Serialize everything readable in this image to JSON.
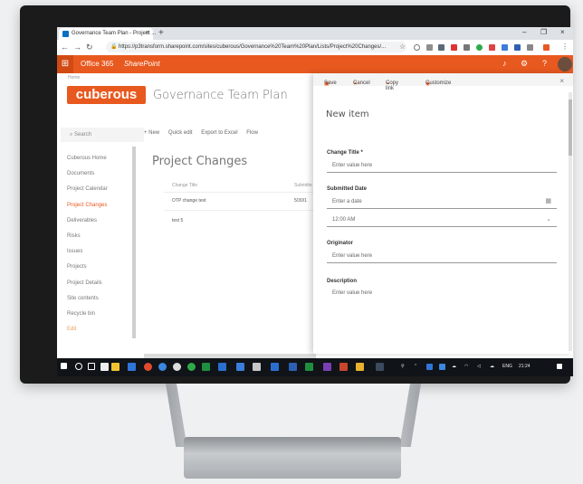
{
  "browser": {
    "tab_title": "Governance Team Plan - Project ...",
    "tab_close": "×",
    "new_tab": "+",
    "window_controls": [
      "–",
      "❐",
      "×"
    ],
    "url": "https://p3transform.sharepoint.com/sites/cuberous/Governance%20Team%20Plan/Lists/Project%20Changes/..."
  },
  "suite": {
    "waffle": "⊞",
    "app_name": "Office 365",
    "product": "SharePoint",
    "bell": "🔔",
    "gear": "⚙",
    "help": "?"
  },
  "site": {
    "breadcrumb": "Home",
    "logo_text": "cuberous",
    "title": "Governance Team Plan"
  },
  "search": {
    "placeholder": "Search"
  },
  "nav": {
    "items": [
      {
        "label": "Cuberous Home"
      },
      {
        "label": "Documents"
      },
      {
        "label": "Project Calendar"
      },
      {
        "label": "Project Changes"
      },
      {
        "label": "Deliverables"
      },
      {
        "label": "Risks"
      },
      {
        "label": "Issues"
      },
      {
        "label": "Projects"
      },
      {
        "label": "Project Details"
      },
      {
        "label": "Site contents"
      },
      {
        "label": "Recycle bin"
      },
      {
        "label": "Edit"
      }
    ]
  },
  "commands": {
    "new": "+ New",
    "quick_edit": "Quick edit",
    "export": "Export to Excel",
    "flow": "Flow"
  },
  "list": {
    "title": "Project Changes",
    "columns": [
      "Change Title",
      "Submitte"
    ],
    "rows": [
      {
        "title": "OTP change test",
        "date": "5/30/1"
      },
      {
        "title": "test 5",
        "date": ""
      }
    ]
  },
  "panel": {
    "save": "Save",
    "cancel": "Cancel",
    "copy_link": "Copy link",
    "customize": "Customize",
    "close": "×",
    "heading": "New item",
    "fields": {
      "change_title_label": "Change Title *",
      "change_title_placeholder": "Enter value here",
      "submitted_date_label": "Submitted Date",
      "date_placeholder": "Enter a date",
      "time_value": "12:00 AM",
      "originator_label": "Originator",
      "originator_placeholder": "Enter value here",
      "description_label": "Description",
      "description_placeholder": "Enter value here"
    }
  },
  "taskbar": {
    "time": "21:24",
    "language": "ENG"
  }
}
